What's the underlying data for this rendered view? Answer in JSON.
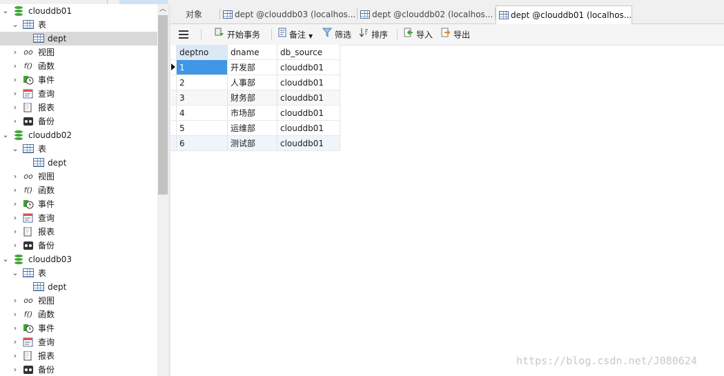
{
  "tree": [
    {
      "kind": "db",
      "label": "clouddb01",
      "expanded": true
    },
    {
      "kind": "folder",
      "icon": "table-icon",
      "label": "表",
      "expanded": true
    },
    {
      "kind": "table",
      "label": "dept",
      "selected": true
    },
    {
      "kind": "folder",
      "icon": "view-icon",
      "label": "视图"
    },
    {
      "kind": "folder",
      "icon": "function-icon",
      "label": "函数"
    },
    {
      "kind": "folder",
      "icon": "event-icon",
      "label": "事件"
    },
    {
      "kind": "folder",
      "icon": "query-icon",
      "label": "查询"
    },
    {
      "kind": "folder",
      "icon": "report-icon",
      "label": "报表"
    },
    {
      "kind": "folder",
      "icon": "backup-icon",
      "label": "备份"
    },
    {
      "kind": "db",
      "label": "clouddb02",
      "expanded": true
    },
    {
      "kind": "folder",
      "icon": "table-icon",
      "label": "表",
      "expanded": true
    },
    {
      "kind": "table",
      "label": "dept"
    },
    {
      "kind": "folder",
      "icon": "view-icon",
      "label": "视图"
    },
    {
      "kind": "folder",
      "icon": "function-icon",
      "label": "函数"
    },
    {
      "kind": "folder",
      "icon": "event-icon",
      "label": "事件"
    },
    {
      "kind": "folder",
      "icon": "query-icon",
      "label": "查询"
    },
    {
      "kind": "folder",
      "icon": "report-icon",
      "label": "报表"
    },
    {
      "kind": "folder",
      "icon": "backup-icon",
      "label": "备份"
    },
    {
      "kind": "db",
      "label": "clouddb03",
      "expanded": true
    },
    {
      "kind": "folder",
      "icon": "table-icon",
      "label": "表",
      "expanded": true
    },
    {
      "kind": "table",
      "label": "dept"
    },
    {
      "kind": "folder",
      "icon": "view-icon",
      "label": "视图"
    },
    {
      "kind": "folder",
      "icon": "function-icon",
      "label": "函数"
    },
    {
      "kind": "folder",
      "icon": "event-icon",
      "label": "事件"
    },
    {
      "kind": "folder",
      "icon": "query-icon",
      "label": "查询"
    },
    {
      "kind": "folder",
      "icon": "report-icon",
      "label": "报表"
    },
    {
      "kind": "folder",
      "icon": "backup-icon",
      "label": "备份"
    }
  ],
  "tabs": {
    "objects": "对象",
    "tab1": "dept @clouddb03 (localhos...",
    "tab2": "dept @clouddb02 (localhos...",
    "tab3": "dept @clouddb01 (localhos..."
  },
  "toolbar": {
    "begin_transaction": "开始事务",
    "memo": "备注",
    "filter": "筛选",
    "sort": "排序",
    "import": "导入",
    "export": "导出"
  },
  "grid": {
    "columns": [
      "deptno",
      "dname",
      "db_source"
    ],
    "rows": [
      [
        "1",
        "开发部",
        "clouddb01"
      ],
      [
        "2",
        "人事部",
        "clouddb01"
      ],
      [
        "3",
        "财务部",
        "clouddb01"
      ],
      [
        "4",
        "市场部",
        "clouddb01"
      ],
      [
        "5",
        "运维部",
        "clouddb01"
      ],
      [
        "6",
        "测试部",
        "clouddb01"
      ]
    ]
  },
  "watermark": "https://blog.csdn.net/J080624",
  "colors": {
    "accent": "#3f97e6",
    "db_green": "#3fa535"
  }
}
